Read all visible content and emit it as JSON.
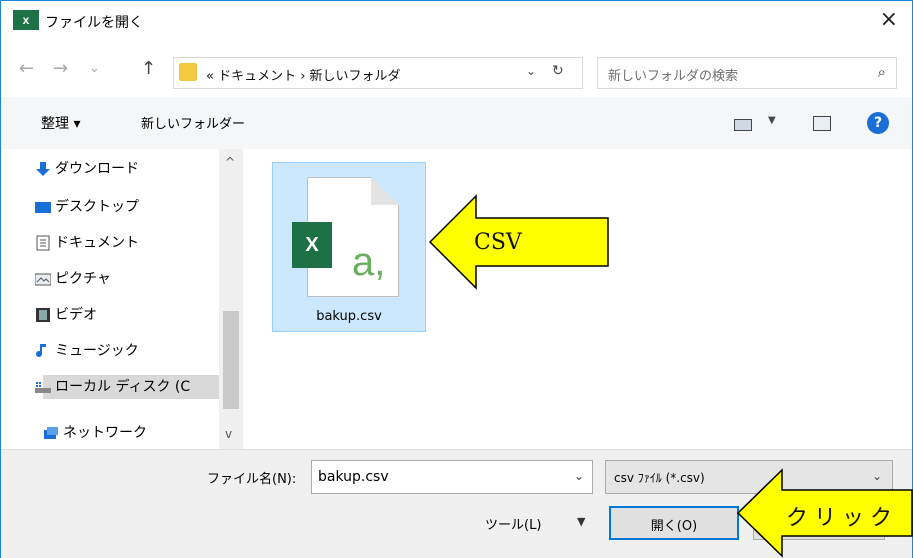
{
  "window": {
    "app_icon": "x",
    "title": "ファイルを開く",
    "close": "×"
  },
  "address_bar": {
    "back": "←",
    "forward": "→",
    "recent": "⌄",
    "up": "↑",
    "path": "« ドキュメント › 新しいフォルダ",
    "dropdown": "⌄",
    "refresh": "↻"
  },
  "search": {
    "placeholder": "新しいフォルダの検索",
    "icon": "⌕"
  },
  "toolbar": {
    "organize": "整理 ▾",
    "new_folder": "新しいフォルダー",
    "view_dropdown": "▼",
    "help": "?"
  },
  "nav_pane": {
    "items": [
      {
        "label": "ダウンロード",
        "icon": "download-icon"
      },
      {
        "label": "デスクトップ",
        "icon": "desktop-icon"
      },
      {
        "label": "ドキュメント",
        "icon": "document-icon"
      },
      {
        "label": "ピクチャ",
        "icon": "pictures-icon"
      },
      {
        "label": "ビデオ",
        "icon": "video-icon"
      },
      {
        "label": "ミュージック",
        "icon": "music-icon"
      },
      {
        "label": "ローカル ディスク (C",
        "icon": "local-disk-icon"
      },
      {
        "label": "ネットワーク",
        "icon": "network-icon"
      }
    ],
    "scroll_up": "^",
    "scroll_down": "v"
  },
  "files": [
    {
      "name": "bakup.csv",
      "badge": "X",
      "letter": "a,"
    }
  ],
  "bottom": {
    "filename_label": "ファイル名(N):",
    "filename_value": "bakup.csv",
    "filename_drop": "⌄",
    "filetype_value": "csv ﾌｧｲﾙ (*.csv)",
    "filetype_drop": "⌄",
    "tools": "ツール(L)",
    "tools_drop": "▼",
    "open": "開く(O)"
  },
  "annotations": {
    "csv_callout": "CSV",
    "click_callout": "クリック",
    "arrow_color": "#ffff00"
  }
}
